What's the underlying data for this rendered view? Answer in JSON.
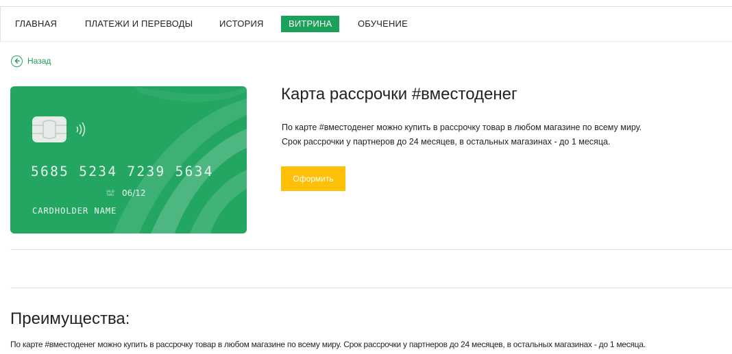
{
  "nav": {
    "items": [
      {
        "label": "ГЛАВНАЯ"
      },
      {
        "label": "ПЛАТЕЖИ И ПЕРЕВОДЫ"
      },
      {
        "label": "ИСТОРИЯ"
      },
      {
        "label": "ВИТРИНА",
        "active": true
      },
      {
        "label": "ОБУЧЕНИЕ"
      }
    ]
  },
  "back": {
    "label": "Назад",
    "icon": "arrow-left-circle-icon"
  },
  "card": {
    "number": "5685 5234 7239 5634",
    "valid_thru": "VALID THRU",
    "expiry": "06/12",
    "holder": "CARDHOLDER NAME",
    "color": "#22a662"
  },
  "product": {
    "title": "Карта рассрочки #вместоденег",
    "description_line1": "По карте #вместоденег можно купить в рассрочку товар в любом магазине по всему миру.",
    "description_line2": "Срок рассрочки у партнеров до 24 месяцев, в остальных магазинах - до 1 месяца.",
    "apply_label": "Оформить"
  },
  "advantages": {
    "title": "Преимущества:",
    "text": "По карте #вместоденег можно купить в рассрочку товар в любом магазине по всему миру. Срок рассрочки у партнеров до 24 месяцев, в остальных магазинах - до 1 месяца."
  },
  "colors": {
    "accent": "#1aa15a",
    "button": "#ffc107"
  }
}
